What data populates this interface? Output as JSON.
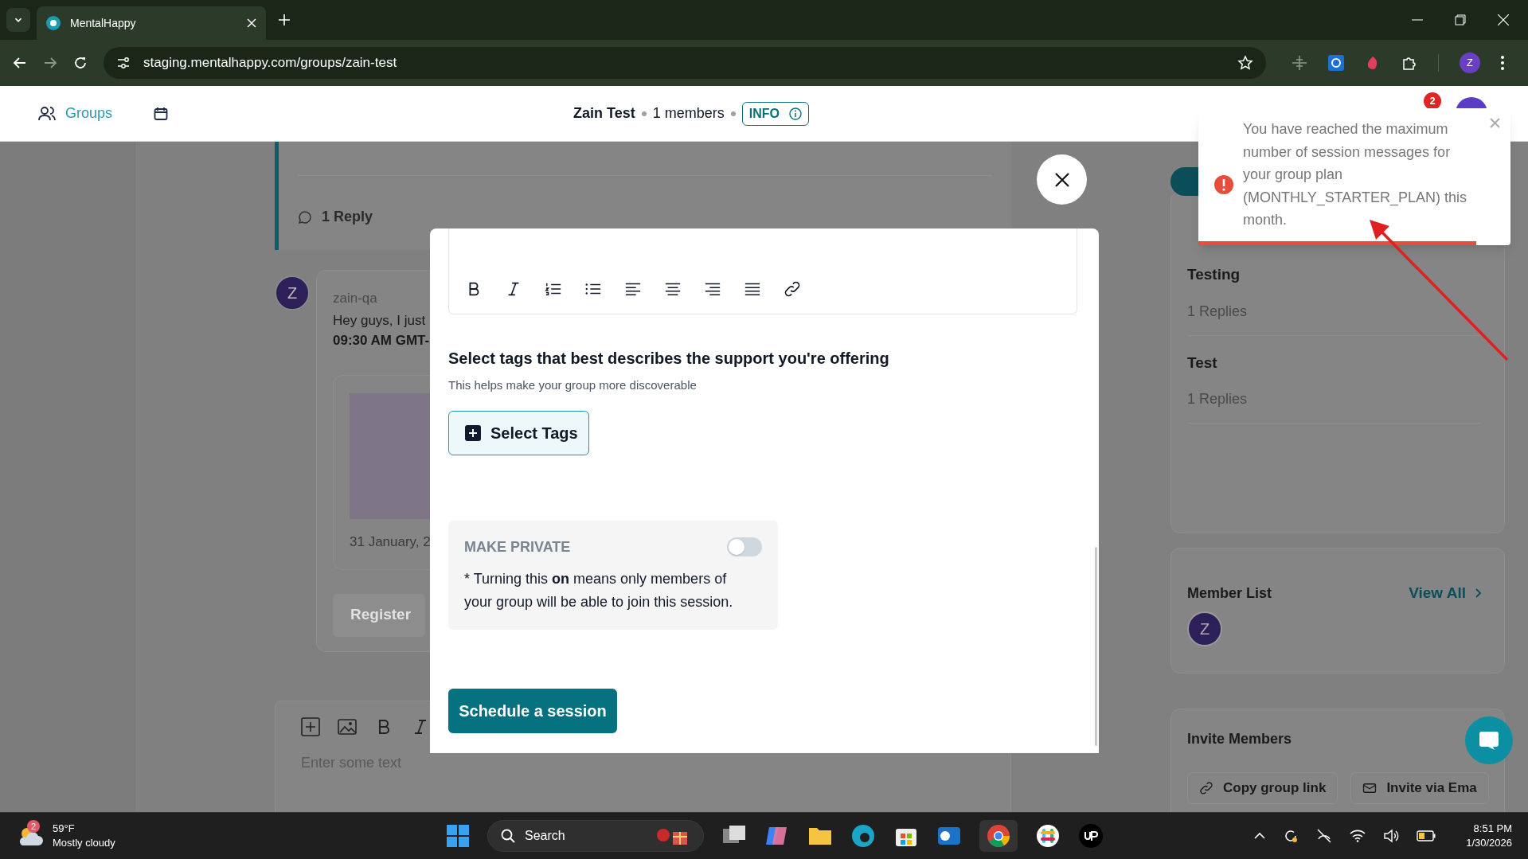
{
  "browser": {
    "tab_title": "MentalHappy",
    "url": "staging.mentalhappy.com/groups/zain-test",
    "profile_initial": "Z"
  },
  "header": {
    "nav_label": "Groups",
    "group_name": "Zain Test",
    "members": "1 members",
    "info": "INFO",
    "notification_count": "2"
  },
  "feed": {
    "post_reply_count": "1 Reply",
    "message": {
      "avatar_initial": "Z",
      "author": "zain-qa",
      "text": "Hey guys, I just",
      "time": "09:30 AM GMT-",
      "date": "31 January, 2",
      "register": "Register"
    },
    "composer": {
      "placeholder": "Enter some text",
      "toolbar": [
        {
          "kind": "add"
        },
        {
          "kind": "image"
        },
        {
          "kind": "bold"
        },
        {
          "kind": "italic"
        }
      ]
    }
  },
  "sidebar": {
    "threads": [
      {
        "title": "Testing",
        "replies": "1 Replies"
      },
      {
        "title": "Test",
        "replies": "1 Replies"
      }
    ],
    "member_list": {
      "title": "Member List",
      "view_all": "View All",
      "members": [
        "Z"
      ]
    },
    "invite": {
      "title": "Invite Members",
      "buttons": [
        {
          "kind": "link",
          "label": "Copy group link"
        },
        {
          "kind": "mail",
          "label": "Invite via Ema"
        }
      ]
    }
  },
  "modal": {
    "toolbar": [
      {
        "kind": "bold"
      },
      {
        "kind": "italic"
      },
      {
        "kind": "ordered-list"
      },
      {
        "kind": "bullet-list"
      },
      {
        "kind": "align-left"
      },
      {
        "kind": "align-center"
      },
      {
        "kind": "align-right"
      },
      {
        "kind": "justify"
      },
      {
        "kind": "link"
      }
    ],
    "tags_heading": "Select tags that best describes the support you're offering",
    "tags_hint": "This helps make your group more discoverable",
    "select_tags": "Select Tags",
    "private": {
      "label": "MAKE PRIVATE",
      "on": false,
      "note": "* Turning this **on** means only members of your group will be able to join this session."
    },
    "submit": "Schedule a session"
  },
  "toast": {
    "message": "You have reached the maximum number of session messages for your group plan (MONTHLY_STARTER_PLAN) this month.",
    "level": 0.89
  },
  "taskbar": {
    "weather": {
      "badge": "2",
      "temp": "59°F",
      "condition": "Mostly cloudy"
    },
    "search": "Search",
    "time": "8:51 PM",
    "date": "1/30/2026"
  }
}
